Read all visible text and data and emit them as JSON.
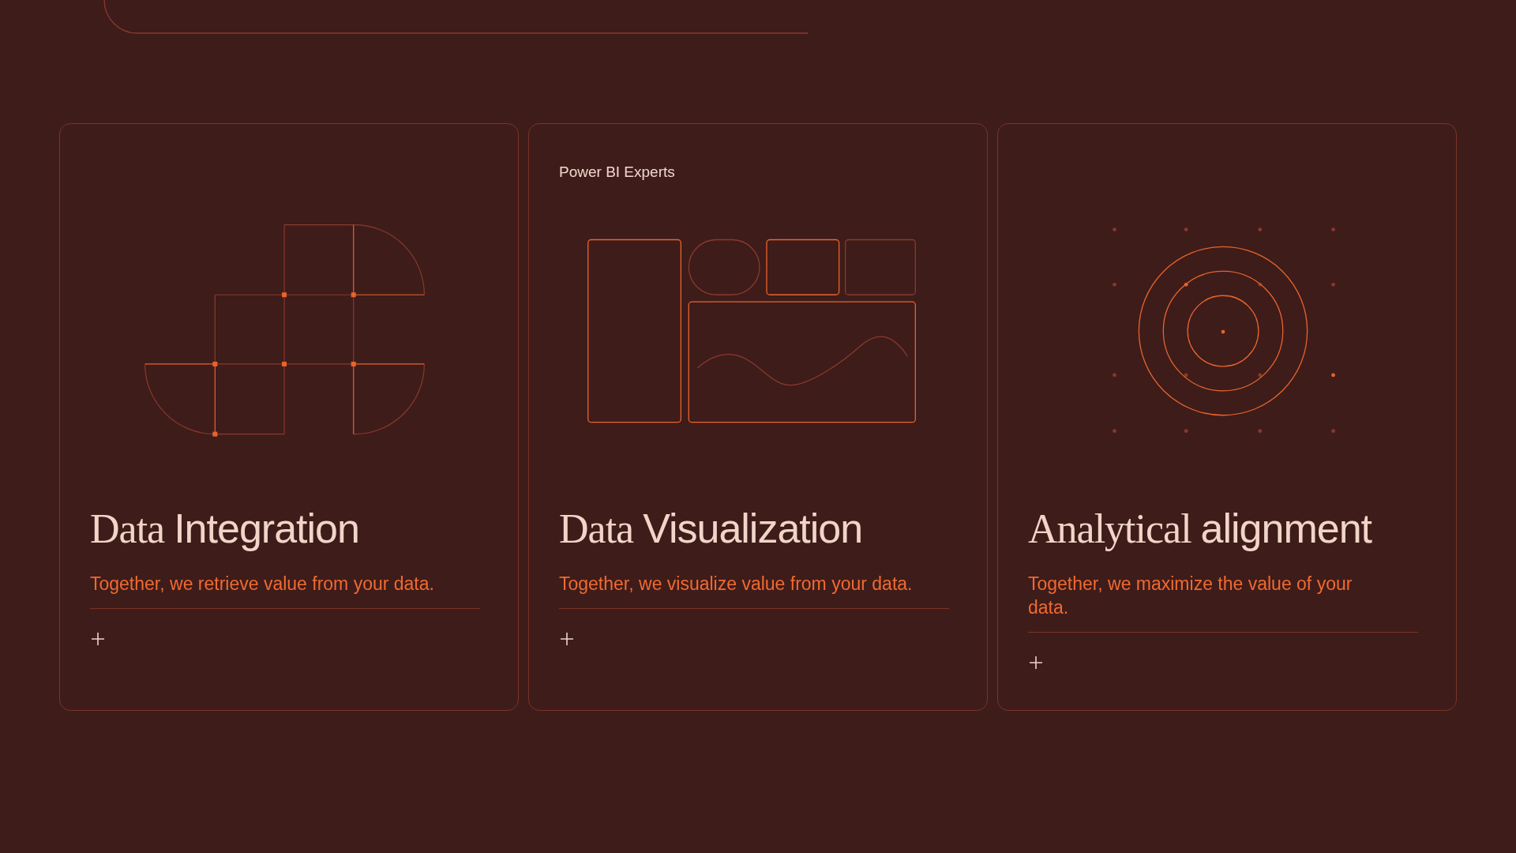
{
  "cards": [
    {
      "kind": "grid",
      "title": [
        {
          "text": "Data",
          "kind": "serif"
        },
        {
          "text": "Integration",
          "kind": "sans"
        }
      ],
      "subtitle": "Together, we retrieve value from your data."
    },
    {
      "eyebrow": "Power BI Experts",
      "kind": "panels",
      "title": [
        {
          "text": "Data",
          "kind": "serif"
        },
        {
          "text": "Visualization",
          "kind": "sans"
        }
      ],
      "subtitle": "Together, we visualize value from your data."
    },
    {
      "kind": "target",
      "title": [
        {
          "text": "Analytical",
          "kind": "serif"
        },
        {
          "text": "alignment",
          "kind": "sans"
        }
      ],
      "subtitle": "Together, we maximize the value of your data."
    }
  ]
}
